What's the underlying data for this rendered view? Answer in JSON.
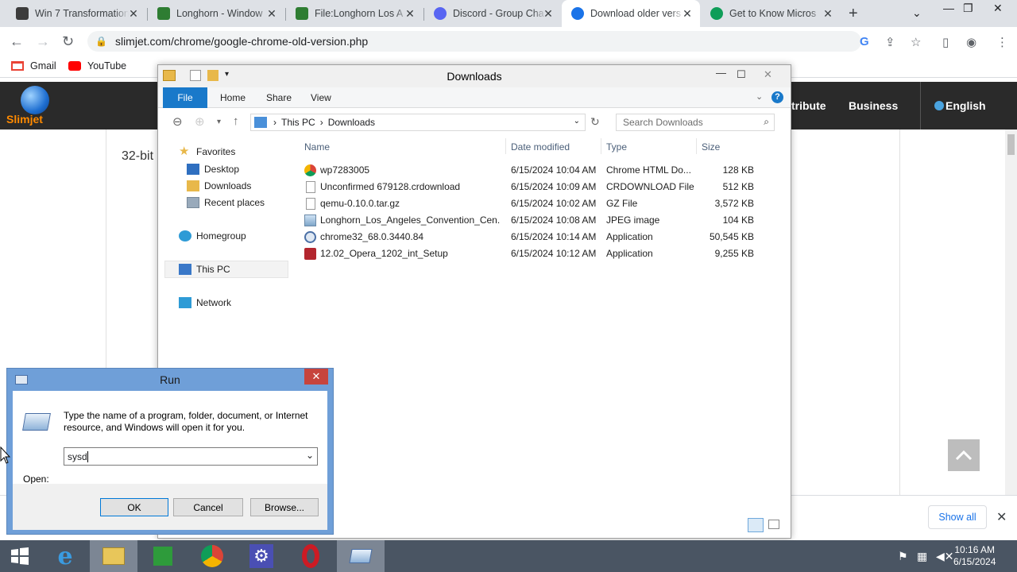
{
  "browser": {
    "tabs": [
      {
        "title": "Win 7 Transformation",
        "favicon_color": "#3c3c3c"
      },
      {
        "title": "Longhorn - Window",
        "favicon_color": "#2e7d32"
      },
      {
        "title": "File:Longhorn Los A",
        "favicon_color": "#2e7d32"
      },
      {
        "title": "Discord - Group Cha",
        "favicon_color": "#5865f2"
      },
      {
        "title": "Download older vers",
        "favicon_color": "#1a73e8",
        "active": true
      },
      {
        "title": "Get to Know Micros",
        "favicon_color": "#0f9d58"
      }
    ],
    "new_tab_label": "+",
    "url": "slimjet.com/chrome/google-chrome-old-version.php",
    "bookmarks": [
      {
        "label": "Gmail",
        "icon": "gmail-icon",
        "color": "#ea4335"
      },
      {
        "label": "YouTube",
        "icon": "youtube-icon",
        "color": "#ff0000"
      }
    ]
  },
  "site": {
    "logo_text": "Slimjet",
    "nav": [
      "tribute",
      "Business",
      "English"
    ],
    "body_text": "32-bit",
    "download_bar": {
      "show_all": "Show all"
    }
  },
  "explorer": {
    "title": "Downloads",
    "ribbon_tabs": [
      "File",
      "Home",
      "Share",
      "View"
    ],
    "breadcrumb": [
      "This PC",
      "Downloads"
    ],
    "search_placeholder": "Search Downloads",
    "sidebar": {
      "favorites": "Favorites",
      "favorites_items": [
        "Desktop",
        "Downloads",
        "Recent places"
      ],
      "homegroup": "Homegroup",
      "this_pc": "This PC",
      "network": "Network"
    },
    "columns": {
      "name": "Name",
      "date": "Date modified",
      "type": "Type",
      "size": "Size"
    },
    "files": [
      {
        "name": "wp7283005",
        "date": "6/15/2024 10:04 AM",
        "type": "Chrome HTML Do...",
        "size": "128 KB",
        "icon": "chrome-html-icon"
      },
      {
        "name": "Unconfirmed 679128.crdownload",
        "date": "6/15/2024 10:09 AM",
        "type": "CRDOWNLOAD File",
        "size": "512 KB",
        "icon": "blank-file-icon"
      },
      {
        "name": "qemu-0.10.0.tar.gz",
        "date": "6/15/2024 10:02 AM",
        "type": "GZ File",
        "size": "3,572 KB",
        "icon": "blank-file-icon"
      },
      {
        "name": "Longhorn_Los_Angeles_Convention_Cen...",
        "date": "6/15/2024 10:08 AM",
        "type": "JPEG image",
        "size": "104 KB",
        "icon": "image-file-icon"
      },
      {
        "name": "chrome32_68.0.3440.84",
        "date": "6/15/2024 10:14 AM",
        "type": "Application",
        "size": "50,545 KB",
        "icon": "installer-icon"
      },
      {
        "name": "12.02_Opera_1202_int_Setup",
        "date": "6/15/2024 10:12 AM",
        "type": "Application",
        "size": "9,255 KB",
        "icon": "opera-setup-icon"
      }
    ]
  },
  "run_dialog": {
    "title": "Run",
    "description": "Type the name of a program, folder, document, or Internet resource, and Windows will open it for you.",
    "open_label": "Open:",
    "input_value": "sysd",
    "ok": "OK",
    "cancel": "Cancel",
    "browse": "Browse..."
  },
  "taskbar": {
    "time": "10:16 AM",
    "date": "6/15/2024"
  }
}
